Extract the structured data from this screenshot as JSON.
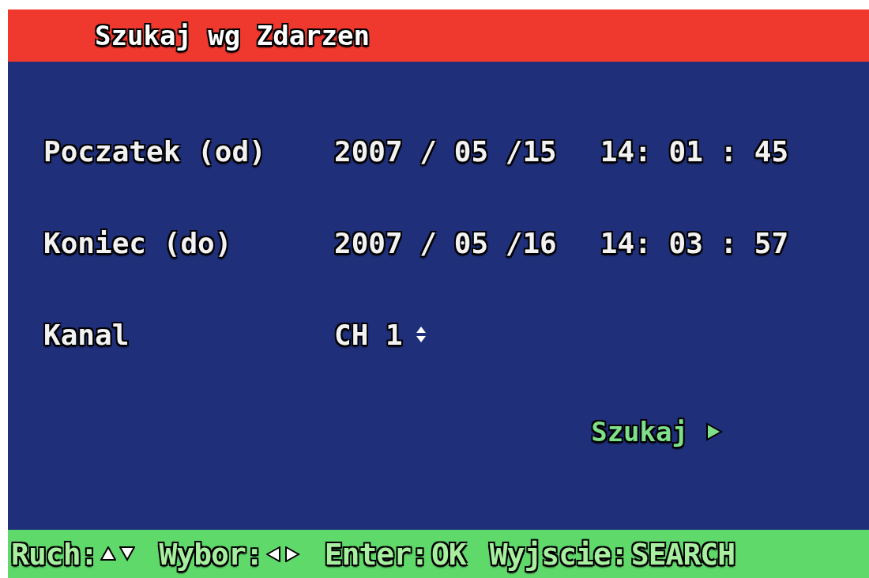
{
  "title": "Szukaj wg Zdarzen",
  "fields": [
    {
      "label": "Poczatek (od)",
      "kind": "datetime",
      "date": "2007 / 05 /15",
      "time": "14: 01 : 45"
    },
    {
      "label": "Koniec (do)",
      "kind": "datetime",
      "date": "2007 / 05 /16",
      "time": "14: 03 : 57"
    },
    {
      "label": "Kanal",
      "kind": "channel",
      "value": "CH 1"
    }
  ],
  "search_button": {
    "label": "Szukaj"
  },
  "hints": [
    {
      "label": "Ruch:",
      "kind": "updown"
    },
    {
      "label": "Wybor:",
      "kind": "leftright"
    },
    {
      "label": "Enter:",
      "kind": "text",
      "value": "OK"
    },
    {
      "label": "Wyjscie:",
      "kind": "text",
      "value": "SEARCH"
    }
  ]
}
